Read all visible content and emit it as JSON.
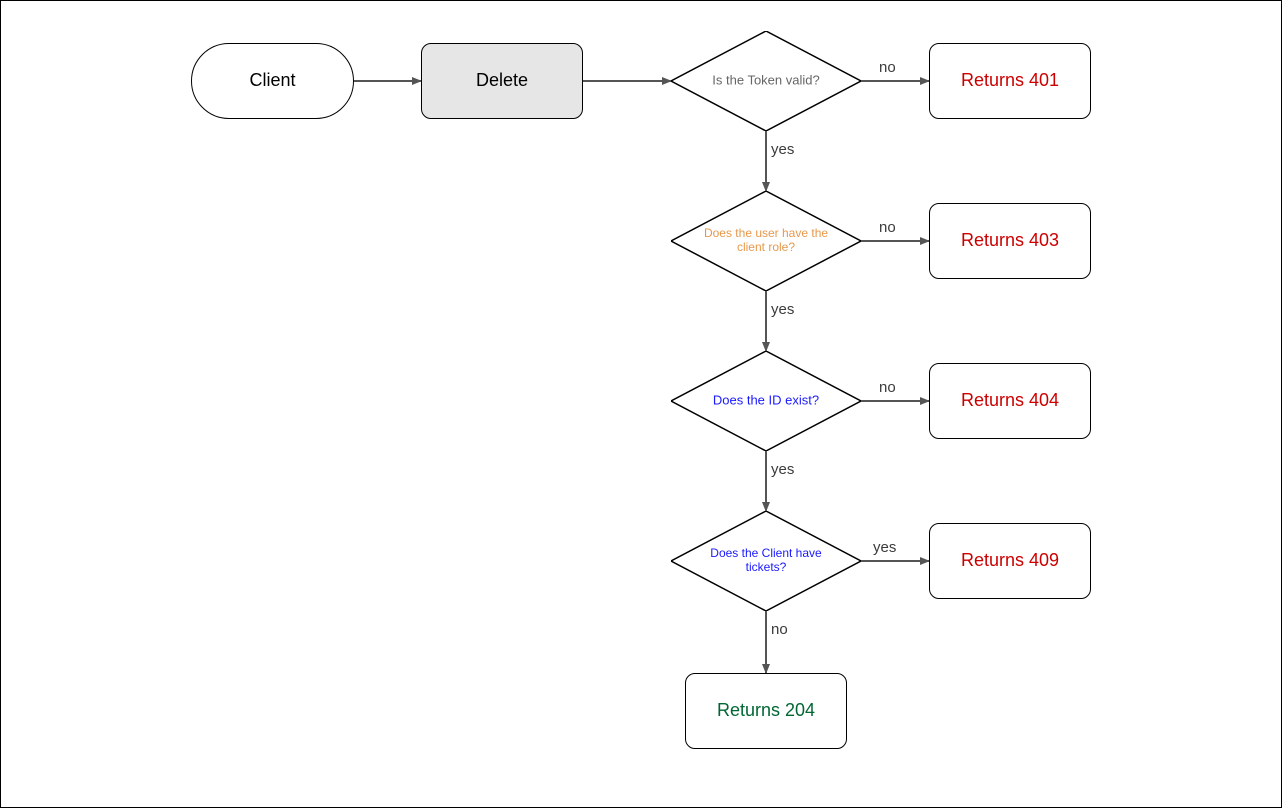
{
  "nodes": {
    "client": "Client",
    "delete": "Delete",
    "token_valid": "Is the Token valid?",
    "user_role": "Does the user have the client role?",
    "id_exist": "Does the ID exist?",
    "client_tickets": "Does the Client have tickets?",
    "ret401": "Returns 401",
    "ret403": "Returns 403",
    "ret404": "Returns 404",
    "ret409": "Returns 409",
    "ret204": "Returns 204"
  },
  "edges": {
    "no": "no",
    "yes": "yes"
  },
  "colors": {
    "decision_gray": "#666666",
    "decision_orange": "#e6994c",
    "decision_blue": "#1a1aff",
    "error": "#cc0000",
    "success": "#006633",
    "arrow": "#555555"
  }
}
